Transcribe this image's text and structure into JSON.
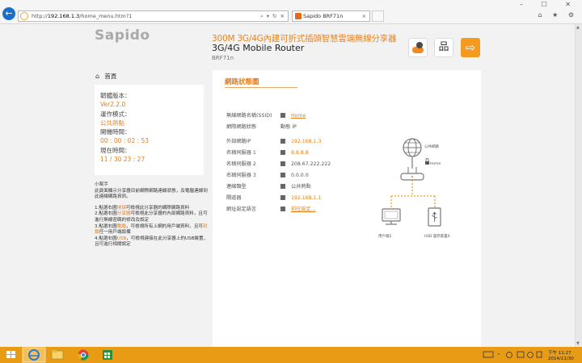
{
  "browser": {
    "url_prefix": "http://",
    "url_host": "192.168.1.3",
    "url_path": "/home_menu.htm?1",
    "addr_controls": "⌕ ▾ ↻ ✕",
    "tab_title": "Sapido BRF71n",
    "tab_close": "×",
    "win_controls": "– ☐ ✕",
    "tools": "⌂ ★ ⚙"
  },
  "header": {
    "logo": "Sapido",
    "product_cn": "300M 3G/4G內建可折式插頭智慧雲端無線分享器",
    "product_en": "3G/4G Mobile Router",
    "model": "BRF71n"
  },
  "sidebar": {
    "home_label": "首頁",
    "info": [
      {
        "key": "韌體版本：",
        "value": "Ver2.2.0"
      },
      {
        "key": "運作模式：",
        "value": "公共熱點"
      },
      {
        "key": "開機時間：",
        "value": "00 : 00 : 02 : 53"
      },
      {
        "key": "現在時間：",
        "value": "11 / 30  23 : 27"
      }
    ],
    "help": {
      "title": "小幫手",
      "intro": "此頁面顯示分享器目前網際網路連線狀態，及電腦連線到此連線網路資訊。",
      "l1a": "1.點選右圖",
      "l1b": "地球",
      "l1c": "可檢視此分享器的網際網路資料",
      "l2a": "2.點選右圖",
      "l2b": "分享器",
      "l2c": "可檢視此分享器的內部網路資料，且可進行無線密碼的修改及設定",
      "l3a": "3.點選右圖",
      "l3b": "電腦",
      "l3c": "，可檢視所有上網的用戶端資料，且可",
      "l3d": "封鎖",
      "l3e": "任一用戶端設備",
      "l4a": "4.點選右圖",
      "l4b": "USB",
      "l4c": "，可檢視連接在此分享器上的USB裝置，且可進行相關設定"
    }
  },
  "content": {
    "title": "網路狀態圖",
    "rows": [
      {
        "label": "無線網路名稱(SSID)",
        "value": "Home"
      },
      {
        "label": "網際網路狀態",
        "value": "動態 IP"
      },
      {
        "label": "外部網路IP",
        "value": "192.168.1.3"
      },
      {
        "label": "名稱伺服器 1",
        "value": "8.8.8.8"
      },
      {
        "label": "名稱伺服器 2",
        "value": "208.67.222.222"
      },
      {
        "label": "名稱伺服器 3",
        "value": "0.0.0.0"
      },
      {
        "label": "連線類型",
        "value": "公共熱點"
      },
      {
        "label": "閘道器",
        "value": "192.168.1.1"
      },
      {
        "label": "網址設定語言",
        "value": "前往設定..."
      }
    ],
    "diagram": {
      "internet_label": "公共網路",
      "router_label": "Home",
      "client_label": "用戶端2",
      "usb_label": "USB 儲存裝置0"
    }
  },
  "taskbar": {
    "time": "下午 11:27",
    "date": "2014/11/30"
  }
}
